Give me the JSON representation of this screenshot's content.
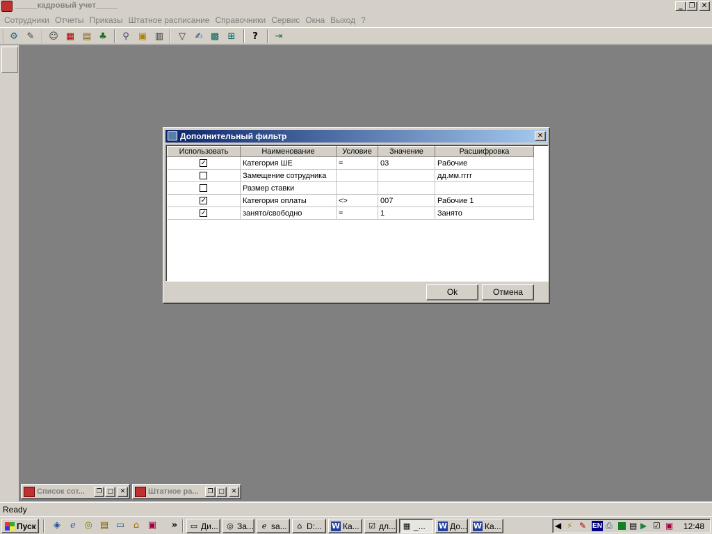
{
  "app": {
    "title": "_____кадровый учет_____",
    "window_buttons": [
      "_",
      "❐",
      "✕"
    ]
  },
  "menu": [
    "Сотрудники",
    "Отчеты",
    "Приказы",
    "Штатное расписание",
    "Справочники",
    "Сервис",
    "Окна",
    "Выход",
    "?"
  ],
  "minimized_windows": [
    {
      "title": "Список сот..."
    },
    {
      "title": "Штатное ра..."
    }
  ],
  "status": {
    "text": "Ready"
  },
  "dialog": {
    "title": "Дополнительный фильтр",
    "columns": [
      "Использовать",
      "Наименование",
      "Условие",
      "Значение",
      "Расшифровка"
    ],
    "rows": [
      {
        "checked": true,
        "name": "Категория ШЕ",
        "condition": "=",
        "value": "03",
        "decode": "Рабочие"
      },
      {
        "checked": false,
        "name": "Замещение сотрудника",
        "condition": "",
        "value": "",
        "decode": "дд.мм.гггг"
      },
      {
        "checked": false,
        "name": "Размер ставки",
        "condition": "",
        "value": "",
        "decode": ""
      },
      {
        "checked": true,
        "name": "Категория оплаты",
        "condition": "<>",
        "value": "007",
        "decode": "Рабочие 1"
      },
      {
        "checked": true,
        "name": "занято/свободно",
        "condition": "=",
        "value": "1",
        "decode": "Занято"
      }
    ],
    "ok_label": "Ok",
    "cancel_label": "Отмена"
  },
  "taskbar": {
    "start_label": "Пуск",
    "tasks": [
      {
        "label": "Ди..."
      },
      {
        "label": "За..."
      },
      {
        "label": "sa..."
      },
      {
        "label": "D:..."
      },
      {
        "label": "Ка..."
      },
      {
        "label": "дл..."
      },
      {
        "label": "_..."
      },
      {
        "label": "До..."
      },
      {
        "label": "Ка..."
      }
    ],
    "language": "EN",
    "clock": "12:48"
  }
}
